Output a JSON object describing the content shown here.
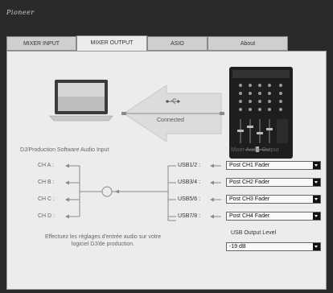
{
  "brand": {
    "logo_text": "Pioneer"
  },
  "tabs": [
    {
      "label": "MIXER INPUT",
      "active": false
    },
    {
      "label": "MIXER OUTPUT",
      "active": true
    },
    {
      "label": "ASIO",
      "active": false
    },
    {
      "label": "About",
      "active": false
    }
  ],
  "connection": {
    "status": "Connected"
  },
  "software": {
    "title": "DJ/Production Software Audio Input",
    "channels": [
      "CH A :",
      "CH B :",
      "CH C :",
      "CH D :"
    ],
    "note": "Effectuez les réglages d'entrée audio sur votre logiciel DJ/de production."
  },
  "mixer": {
    "title": "Mixer Audio Output",
    "usb_outputs": [
      {
        "label": "USB1/2 :",
        "value": "Post CH1 Fader"
      },
      {
        "label": "USB3/4 :",
        "value": "Post CH2 Fader"
      },
      {
        "label": "USB5/6 :",
        "value": "Post CH3 Fader"
      },
      {
        "label": "USB7/8 :",
        "value": "Post CH4 Fader"
      }
    ],
    "level_label": "USB Output Level",
    "level_value": "-19 dB"
  },
  "colors": {
    "panel": "#ececec",
    "frame": "#2a2a2a",
    "tab_inactive": "#cfcfcf",
    "arrow": "#dcdcdc"
  }
}
